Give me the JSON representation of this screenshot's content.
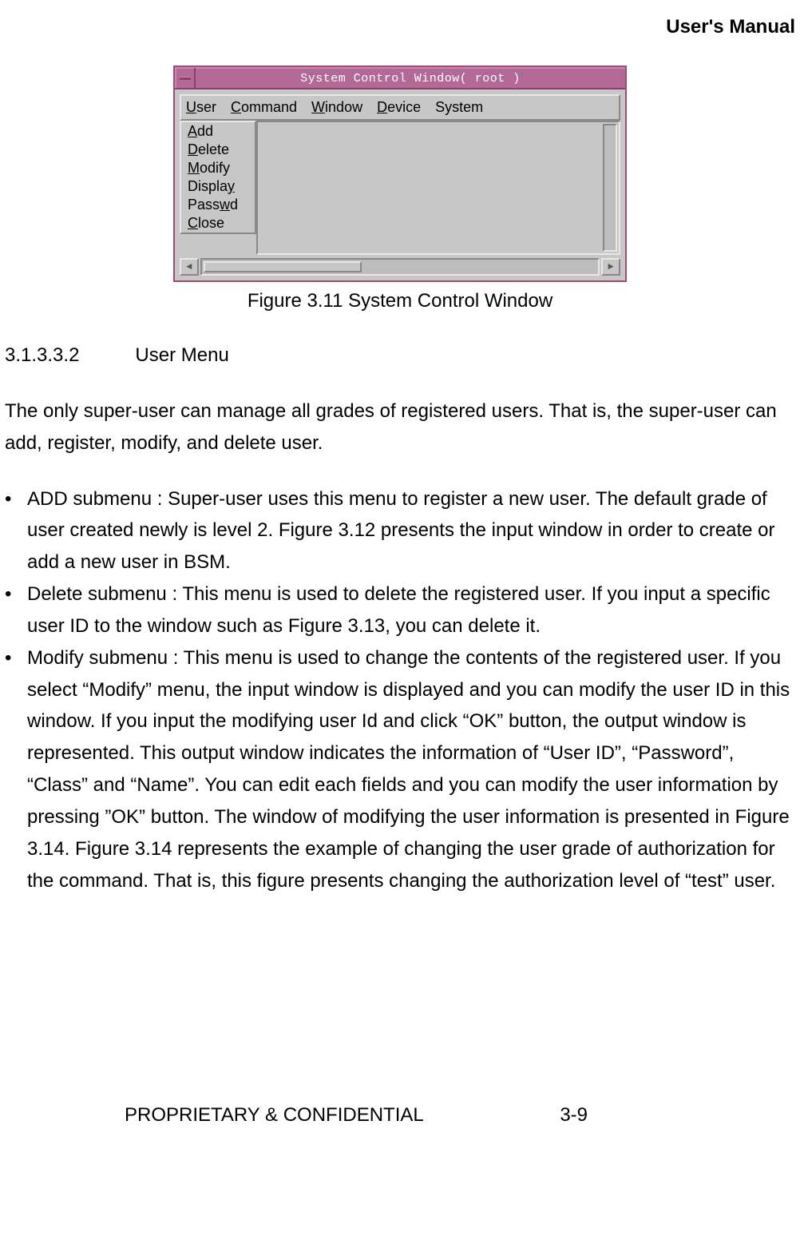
{
  "header": {
    "title": "User's Manual"
  },
  "figure": {
    "window_title": "System Control Window( root )",
    "menubar": [
      {
        "label": "User",
        "ul": "U",
        "rest": "ser"
      },
      {
        "label": "Command",
        "ul": "C",
        "rest": "ommand"
      },
      {
        "label": "Window",
        "ul": "W",
        "rest": "indow"
      },
      {
        "label": "Device",
        "ul": "D",
        "rest": "evice"
      },
      {
        "label": "System",
        "ul": "",
        "rest": "System"
      }
    ],
    "dropdown": [
      {
        "ul": "A",
        "rest": "dd"
      },
      {
        "ul": "D",
        "rest": "elete"
      },
      {
        "ul": "M",
        "rest": "odify"
      },
      {
        "pre": "Displa",
        "ul": "y",
        "rest": ""
      },
      {
        "pre": "Pass",
        "ul": "w",
        "rest": "d"
      },
      {
        "ul": "C",
        "rest": "lose"
      }
    ],
    "caption": "Figure 3.11 System Control Window"
  },
  "section": {
    "number": "3.1.3.3.2",
    "title": "User Menu"
  },
  "paragraph": "The only super-user can manage all grades of registered users. That is, the super-user can add, register, modify, and delete user.",
  "bullets": [
    "ADD submenu :  Super-user uses this menu to register a new user. The default grade of user created newly is level 2. Figure 3.12 presents the input window in order to create or add a new user in BSM.",
    "Delete submenu :  This menu is used to delete the registered user. If you input a specific user ID to the window such as Figure 3.13, you can delete it.",
    "Modify submenu :  This menu is used to change the contents of the registered user. If you select “Modify” menu, the input window is displayed and you can modify the user ID in this window. If you input the modifying user Id and click “OK” button, the output window is represented. This output window indicates the information of “User ID”, “Password”, “Class” and “Name”. You can edit each fields and you can modify the user information by pressing ”OK” button. The window of modifying the user information is presented in Figure 3.14. Figure 3.14 represents the example of changing the user grade of authorization for the command. That is, this figure presents changing the authorization level of “test” user."
  ],
  "footer": {
    "left": "PROPRIETARY & CONFIDENTIAL",
    "right": "3-9"
  }
}
